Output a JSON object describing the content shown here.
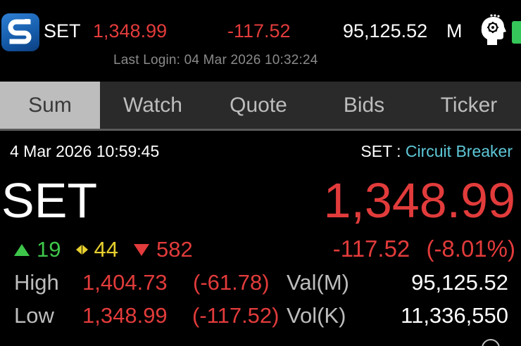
{
  "header": {
    "market_name": "SET",
    "index_value": "1,348.99",
    "index_change": "-117.52",
    "turnover_value": "95,125.52",
    "turnover_unit": "M",
    "last_login": "Last Login: 04 Mar 2026 10:32:24"
  },
  "tabs": [
    {
      "label": "Sum",
      "active": true
    },
    {
      "label": "Watch",
      "active": false
    },
    {
      "label": "Quote",
      "active": false
    },
    {
      "label": "Bids",
      "active": false
    },
    {
      "label": "Ticker",
      "active": false
    }
  ],
  "summary": {
    "timestamp": "4 Mar 2026 10:59:45",
    "market": "SET",
    "separator": ":",
    "status": "Circuit Breaker",
    "name": "SET",
    "index": "1,348.99",
    "advances": "19",
    "unchanged": "44",
    "declines": "582",
    "change": "-117.52",
    "change_pct": "(-8.01%)",
    "high_label": "High",
    "high_value": "1,404.73",
    "high_change": "(-61.78)",
    "low_label": "Low",
    "low_value": "1,348.99",
    "low_change": "(-117.52)",
    "val_label": "Val(M)",
    "val_value": "95,125.52",
    "vol_label": "Vol(K)",
    "vol_value": "11,336,550"
  },
  "colors": {
    "up": "#3ec64a",
    "unchanged": "#e7cf2f",
    "down": "#e23b3b",
    "status": "#5ec8d8",
    "background": "#000000",
    "battery": "#35c759"
  },
  "icons": {
    "app_logo": "set-logo-icon",
    "profile": "head-ai-icon",
    "battery": "battery-icon"
  }
}
